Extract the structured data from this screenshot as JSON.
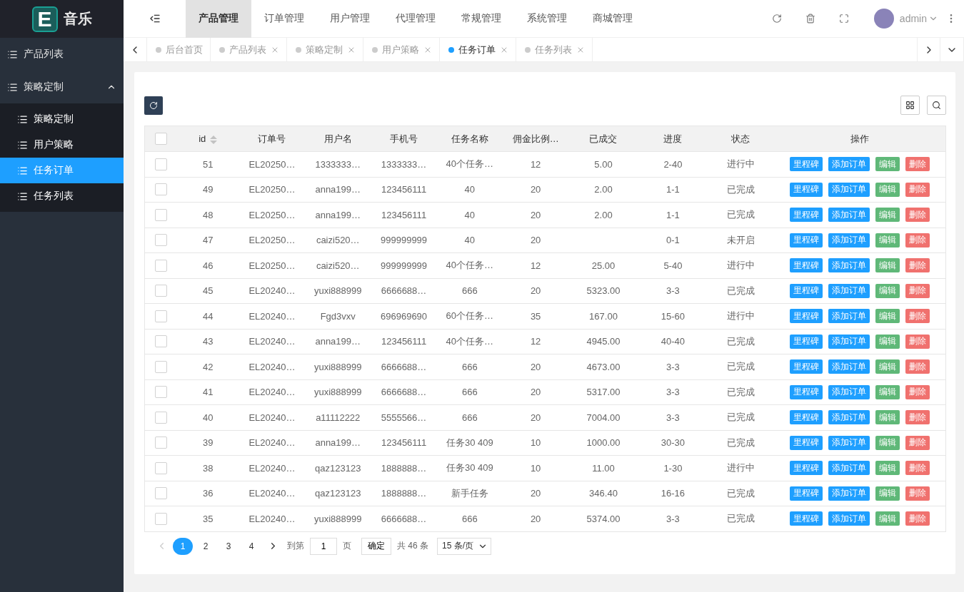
{
  "logo": {
    "letter": "E",
    "title": "音乐"
  },
  "sidebar": {
    "items": [
      {
        "label": "产品列表",
        "selected": false
      },
      {
        "label": "策略定制",
        "expanded": true,
        "selected": false,
        "children": [
          {
            "label": "策略定制",
            "selected": false
          },
          {
            "label": "用户策略",
            "selected": false
          },
          {
            "label": "任务订单",
            "selected": true
          },
          {
            "label": "任务列表",
            "selected": false
          }
        ]
      }
    ]
  },
  "top_nav": [
    {
      "label": "产品管理",
      "selected": true
    },
    {
      "label": "订单管理",
      "selected": false
    },
    {
      "label": "用户管理",
      "selected": false
    },
    {
      "label": "代理管理",
      "selected": false
    },
    {
      "label": "常规管理",
      "selected": false
    },
    {
      "label": "系统管理",
      "selected": false
    },
    {
      "label": "商城管理",
      "selected": false
    }
  ],
  "user": {
    "name": "admin"
  },
  "page_tabs": [
    {
      "label": "后台首页",
      "selected": false,
      "closable": false
    },
    {
      "label": "产品列表",
      "selected": false,
      "closable": true
    },
    {
      "label": "策略定制",
      "selected": false,
      "closable": true
    },
    {
      "label": "用户策略",
      "selected": false,
      "closable": true
    },
    {
      "label": "任务订单",
      "selected": true,
      "closable": true
    },
    {
      "label": "任务列表",
      "selected": false,
      "closable": true
    }
  ],
  "table": {
    "select_all": false,
    "columns": [
      "id",
      "订单号",
      "用户名",
      "手机号",
      "任务名称",
      "佣金比例…",
      "已成交",
      "进度",
      "状态",
      "操作"
    ],
    "rows": [
      {
        "checked": false,
        "cells": [
          "51",
          "EL20250…",
          "1333333…",
          "1333333…",
          "40个任务…",
          "12",
          "5.00",
          "2-40",
          "进行中"
        ],
        "actions": [
          "里程碑",
          "添加订单",
          "编辑",
          "删除"
        ]
      },
      {
        "checked": false,
        "cells": [
          "49",
          "EL20250…",
          "anna199…",
          "123456111",
          "40",
          "20",
          "2.00",
          "1-1",
          "已完成"
        ],
        "actions": [
          "里程碑",
          "添加订单",
          "编辑",
          "删除"
        ]
      },
      {
        "checked": false,
        "cells": [
          "48",
          "EL20250…",
          "anna199…",
          "123456111",
          "40",
          "20",
          "2.00",
          "1-1",
          "已完成"
        ],
        "actions": [
          "里程碑",
          "添加订单",
          "编辑",
          "删除"
        ]
      },
      {
        "checked": false,
        "cells": [
          "47",
          "EL20250…",
          "caizi520…",
          "999999999",
          "40",
          "20",
          "",
          "0-1",
          "未开启"
        ],
        "actions": [
          "里程碑",
          "添加订单",
          "编辑",
          "删除"
        ]
      },
      {
        "checked": false,
        "cells": [
          "46",
          "EL20250…",
          "caizi520…",
          "999999999",
          "40个任务…",
          "12",
          "25.00",
          "5-40",
          "进行中"
        ],
        "actions": [
          "里程碑",
          "添加订单",
          "编辑",
          "删除"
        ]
      },
      {
        "checked": false,
        "cells": [
          "45",
          "EL20240…",
          "yuxi888999",
          "6666688…",
          "666",
          "20",
          "5323.00",
          "3-3",
          "已完成"
        ],
        "actions": [
          "里程碑",
          "添加订单",
          "编辑",
          "删除"
        ]
      },
      {
        "checked": false,
        "cells": [
          "44",
          "EL20240…",
          "Fgd3vxv",
          "696969690",
          "60个任务…",
          "35",
          "167.00",
          "15-60",
          "进行中"
        ],
        "actions": [
          "里程碑",
          "添加订单",
          "编辑",
          "删除"
        ]
      },
      {
        "checked": false,
        "cells": [
          "43",
          "EL20240…",
          "anna199…",
          "123456111",
          "40个任务…",
          "12",
          "4945.00",
          "40-40",
          "已完成"
        ],
        "actions": [
          "里程碑",
          "添加订单",
          "编辑",
          "删除"
        ]
      },
      {
        "checked": false,
        "cells": [
          "42",
          "EL20240…",
          "yuxi888999",
          "6666688…",
          "666",
          "20",
          "4673.00",
          "3-3",
          "已完成"
        ],
        "actions": [
          "里程碑",
          "添加订单",
          "编辑",
          "删除"
        ]
      },
      {
        "checked": false,
        "cells": [
          "41",
          "EL20240…",
          "yuxi888999",
          "6666688…",
          "666",
          "20",
          "5317.00",
          "3-3",
          "已完成"
        ],
        "actions": [
          "里程碑",
          "添加订单",
          "编辑",
          "删除"
        ]
      },
      {
        "checked": false,
        "cells": [
          "40",
          "EL20240…",
          "a11112222",
          "5555566…",
          "666",
          "20",
          "7004.00",
          "3-3",
          "已完成"
        ],
        "actions": [
          "里程碑",
          "添加订单",
          "编辑",
          "删除"
        ]
      },
      {
        "checked": false,
        "cells": [
          "39",
          "EL20240…",
          "anna199…",
          "123456111",
          "任务30 409",
          "10",
          "1000.00",
          "30-30",
          "已完成"
        ],
        "actions": [
          "里程碑",
          "添加订单",
          "编辑",
          "删除"
        ]
      },
      {
        "checked": false,
        "cells": [
          "38",
          "EL20240…",
          "qaz123123",
          "1888888…",
          "任务30 409",
          "10",
          "11.00",
          "1-30",
          "进行中"
        ],
        "actions": [
          "里程碑",
          "添加订单",
          "编辑",
          "删除"
        ]
      },
      {
        "checked": false,
        "cells": [
          "36",
          "EL20240…",
          "qaz123123",
          "1888888…",
          "新手任务",
          "20",
          "346.40",
          "16-16",
          "已完成"
        ],
        "actions": [
          "里程碑",
          "添加订单",
          "编辑",
          "删除"
        ]
      },
      {
        "checked": false,
        "cells": [
          "35",
          "EL20240…",
          "yuxi888999",
          "6666688…",
          "666",
          "20",
          "5374.00",
          "3-3",
          "已完成"
        ],
        "actions": [
          "里程碑",
          "添加订单",
          "编辑",
          "删除"
        ]
      }
    ]
  },
  "pagination": {
    "pages": [
      {
        "label": "1",
        "selected": true
      },
      {
        "label": "2",
        "selected": false
      },
      {
        "label": "3",
        "selected": false
      },
      {
        "label": "4",
        "selected": false
      }
    ],
    "prev_disabled": true,
    "goto_label": "到第",
    "goto_value": "1",
    "page_unit": "页",
    "confirm": "确定",
    "total": "共 46 条",
    "page_size": "15 条/页"
  }
}
